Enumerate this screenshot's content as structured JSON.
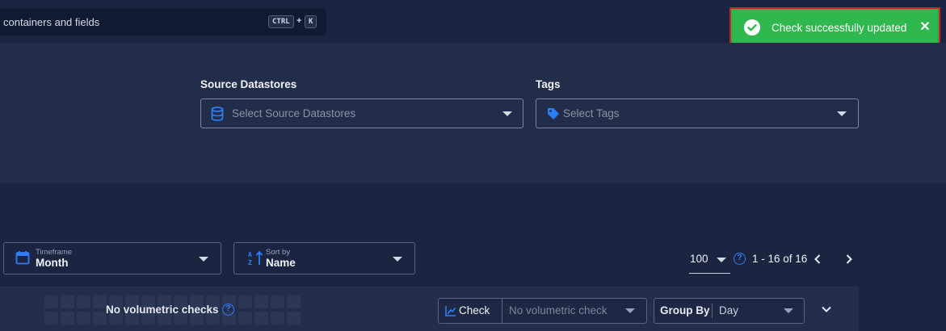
{
  "search": {
    "text": "containers and fields",
    "shortcut_key1": "CTRL",
    "shortcut_plus": "+",
    "shortcut_key2": "K"
  },
  "toast": {
    "message": "Check successfully updated",
    "close": "✕",
    "status_color": "#2eb84e",
    "highlight_color": "#d2202a"
  },
  "filters": {
    "source_label": "Source Datastores",
    "source_placeholder": "Select Source Datastores",
    "tags_label": "Tags",
    "tags_placeholder": "Select Tags"
  },
  "controls": {
    "timeframe_label": "Timeframe",
    "timeframe_value": "Month",
    "sort_label": "Sort by",
    "sort_value": "Name",
    "page_size": "100",
    "help": "?",
    "range": "1 - 16 of 16"
  },
  "check_row": {
    "no_volumetric": "No volumetric checks",
    "help": "?",
    "check_button": "Check",
    "check_placeholder": "No volumetric check",
    "group_by_label": "Group By",
    "group_by_value": "Day"
  },
  "colors": {
    "accent": "#2f7df6",
    "background": "#1b2541"
  },
  "icons": [
    "check-circle-icon",
    "close-icon",
    "database-icon",
    "tag-icon",
    "calendar-icon",
    "sort-az-icon",
    "help-icon",
    "chevron-left-icon",
    "chevron-right-icon",
    "trend-icon",
    "chevron-down-icon"
  ]
}
